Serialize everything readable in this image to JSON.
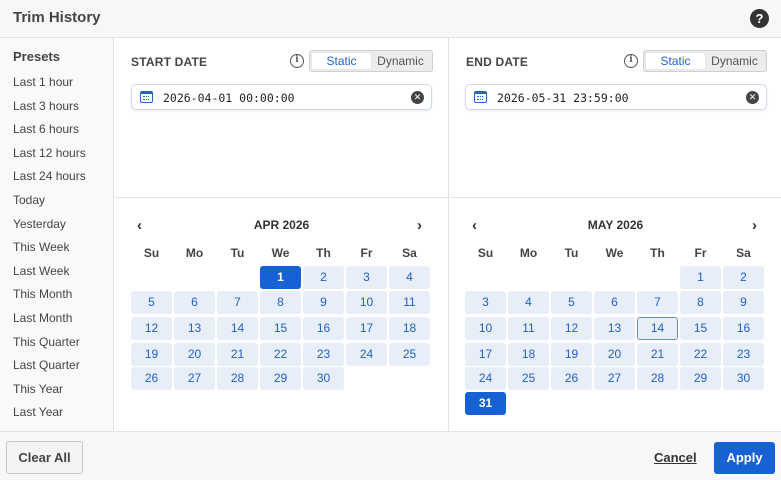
{
  "header": {
    "title": "Trim History",
    "help_icon": "question-circle-icon"
  },
  "sidebar": {
    "title": "Presets",
    "items": [
      "Last 1 hour",
      "Last 3 hours",
      "Last 6 hours",
      "Last 12 hours",
      "Last 24 hours",
      "Today",
      "Yesterday",
      "This Week",
      "Last Week",
      "This Month",
      "Last Month",
      "This Quarter",
      "Last Quarter",
      "This Year",
      "Last Year"
    ]
  },
  "start": {
    "label": "START DATE",
    "info_icon": "info-icon",
    "toggle": {
      "static": "Static",
      "dynamic": "Dynamic",
      "active": "static"
    },
    "value": "2026-04-01 00:00:00",
    "calendar": {
      "title": "APR 2026",
      "prev": "‹",
      "next": "›",
      "weekdays": [
        "Su",
        "Mo",
        "Tu",
        "We",
        "Th",
        "Fr",
        "Sa"
      ],
      "first_weekday": 3,
      "days_in_month": 30,
      "selected_day": 1,
      "today_day": null
    }
  },
  "end": {
    "label": "END DATE",
    "info_icon": "info-icon",
    "toggle": {
      "static": "Static",
      "dynamic": "Dynamic",
      "active": "static"
    },
    "value": "2026-05-31 23:59:00",
    "calendar": {
      "title": "MAY 2026",
      "prev": "‹",
      "next": "›",
      "weekdays": [
        "Su",
        "Mo",
        "Tu",
        "We",
        "Th",
        "Fr",
        "Sa"
      ],
      "first_weekday": 5,
      "days_in_month": 31,
      "selected_day": 31,
      "today_day": 14
    }
  },
  "footer": {
    "clear_all": "Clear All",
    "cancel": "Cancel",
    "apply": "Apply"
  },
  "colors": {
    "accent": "#1662d4",
    "day_bg": "#e7eef8",
    "day_text": "#2460c4"
  }
}
